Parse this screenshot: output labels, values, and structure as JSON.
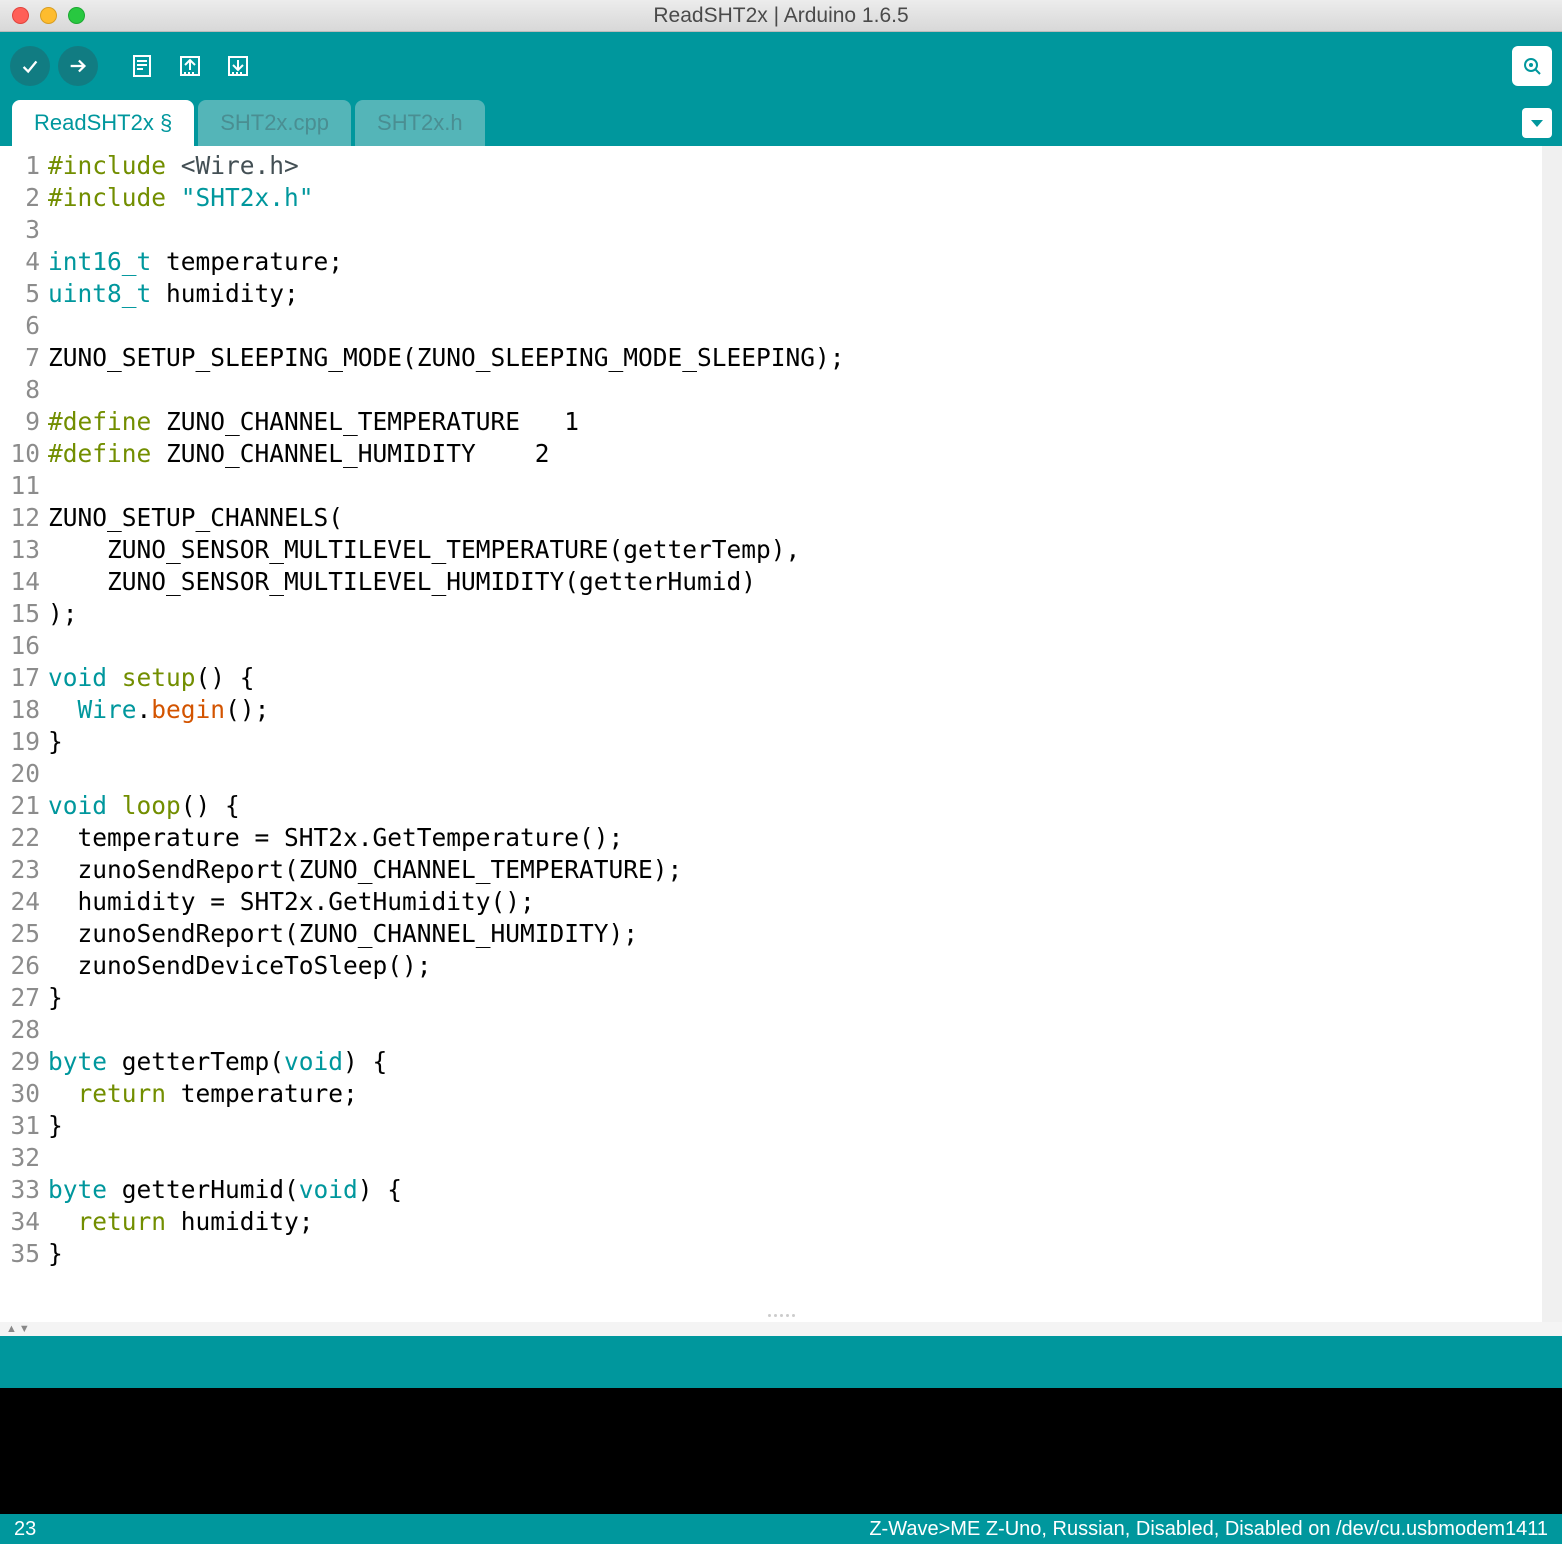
{
  "window": {
    "title": "ReadSHT2x | Arduino 1.6.5"
  },
  "tabs": [
    {
      "label": "ReadSHT2x §",
      "active": true
    },
    {
      "label": "SHT2x.cpp",
      "active": false
    },
    {
      "label": "SHT2x.h",
      "active": false
    }
  ],
  "code": {
    "lines": [
      [
        {
          "t": "#include ",
          "c": "k-pre"
        },
        {
          "t": "<Wire.h>",
          "c": "k-inc"
        }
      ],
      [
        {
          "t": "#include ",
          "c": "k-pre"
        },
        {
          "t": "\"SHT2x.h\"",
          "c": "k-str"
        }
      ],
      [
        {
          "t": ""
        }
      ],
      [
        {
          "t": "int16_t",
          "c": "k-type"
        },
        {
          "t": " temperature;"
        }
      ],
      [
        {
          "t": "uint8_t",
          "c": "k-type"
        },
        {
          "t": " humidity;"
        }
      ],
      [
        {
          "t": ""
        }
      ],
      [
        {
          "t": "ZUNO_SETUP_SLEEPING_MODE(ZUNO_SLEEPING_MODE_SLEEPING);"
        }
      ],
      [
        {
          "t": ""
        }
      ],
      [
        {
          "t": "#define",
          "c": "k-pre"
        },
        {
          "t": " ZUNO_CHANNEL_TEMPERATURE   1"
        }
      ],
      [
        {
          "t": "#define",
          "c": "k-pre"
        },
        {
          "t": " ZUNO_CHANNEL_HUMIDITY    2"
        }
      ],
      [
        {
          "t": ""
        }
      ],
      [
        {
          "t": "ZUNO_SETUP_CHANNELS("
        }
      ],
      [
        {
          "t": "    ZUNO_SENSOR_MULTILEVEL_TEMPERATURE(getterTemp),"
        }
      ],
      [
        {
          "t": "    ZUNO_SENSOR_MULTILEVEL_HUMIDITY(getterHumid)"
        }
      ],
      [
        {
          "t": ");"
        }
      ],
      [
        {
          "t": ""
        }
      ],
      [
        {
          "t": "void",
          "c": "k-type"
        },
        {
          "t": " "
        },
        {
          "t": "setup",
          "c": "k-kw"
        },
        {
          "t": "() {"
        }
      ],
      [
        {
          "t": "  "
        },
        {
          "t": "Wire",
          "c": "k-lit"
        },
        {
          "t": "."
        },
        {
          "t": "begin",
          "c": "k-fn"
        },
        {
          "t": "();"
        }
      ],
      [
        {
          "t": "}"
        }
      ],
      [
        {
          "t": ""
        }
      ],
      [
        {
          "t": "void",
          "c": "k-type"
        },
        {
          "t": " "
        },
        {
          "t": "loop",
          "c": "k-kw"
        },
        {
          "t": "() {"
        }
      ],
      [
        {
          "t": "  temperature = SHT2x.GetTemperature();"
        }
      ],
      [
        {
          "t": "  zunoSendReport(ZUNO_CHANNEL_TEMPERATURE);"
        }
      ],
      [
        {
          "t": "  humidity = SHT2x.GetHumidity();"
        }
      ],
      [
        {
          "t": "  zunoSendReport(ZUNO_CHANNEL_HUMIDITY);"
        }
      ],
      [
        {
          "t": "  zunoSendDeviceToSleep();"
        }
      ],
      [
        {
          "t": "}"
        }
      ],
      [
        {
          "t": ""
        }
      ],
      [
        {
          "t": "byte",
          "c": "k-type"
        },
        {
          "t": " getterTemp("
        },
        {
          "t": "void",
          "c": "k-type"
        },
        {
          "t": ") {"
        }
      ],
      [
        {
          "t": "  "
        },
        {
          "t": "return",
          "c": "k-kw"
        },
        {
          "t": " temperature;"
        }
      ],
      [
        {
          "t": "}"
        }
      ],
      [
        {
          "t": ""
        }
      ],
      [
        {
          "t": "byte",
          "c": "k-type"
        },
        {
          "t": " getterHumid("
        },
        {
          "t": "void",
          "c": "k-type"
        },
        {
          "t": ") {"
        }
      ],
      [
        {
          "t": "  "
        },
        {
          "t": "return",
          "c": "k-kw"
        },
        {
          "t": " humidity;"
        }
      ],
      [
        {
          "t": "}"
        }
      ]
    ]
  },
  "status": {
    "line_number": "23",
    "board_info": "Z-Wave>ME Z-Uno, Russian, Disabled, Disabled on /dev/cu.usbmodem1411"
  }
}
